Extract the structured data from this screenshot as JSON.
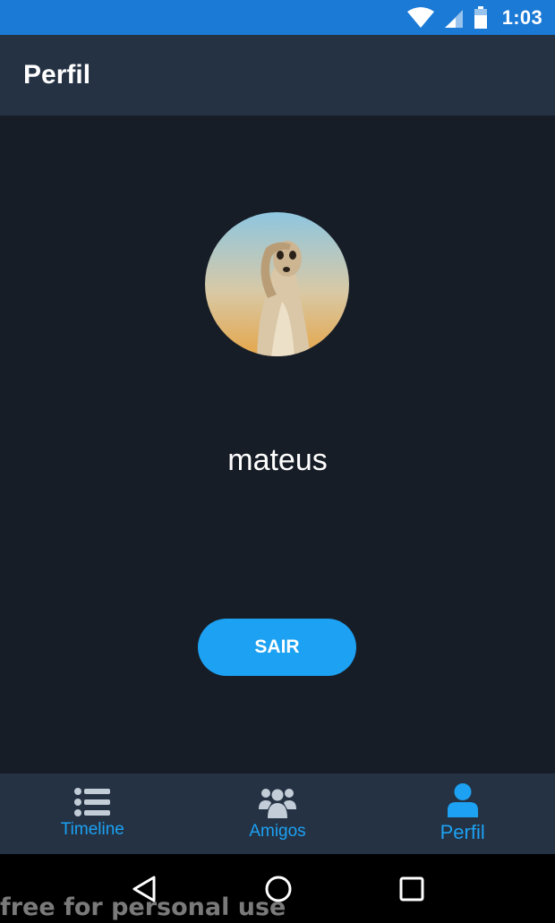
{
  "status_bar": {
    "time": "1:03"
  },
  "app_bar": {
    "title": "Perfil"
  },
  "profile": {
    "username": "mateus",
    "logout_label": "SAIR"
  },
  "bottom_nav": {
    "items": [
      {
        "label": "Timeline",
        "icon": "list-icon"
      },
      {
        "label": "Amigos",
        "icon": "group-icon"
      },
      {
        "label": "Perfil",
        "icon": "person-icon",
        "active": true
      }
    ]
  },
  "watermark": "free for personal use",
  "colors": {
    "status_bar": "#1a7ad6",
    "app_bar": "#243244",
    "background": "#171d27",
    "accent": "#1da1f2",
    "nav_icon_inactive": "#c3cdd8"
  }
}
